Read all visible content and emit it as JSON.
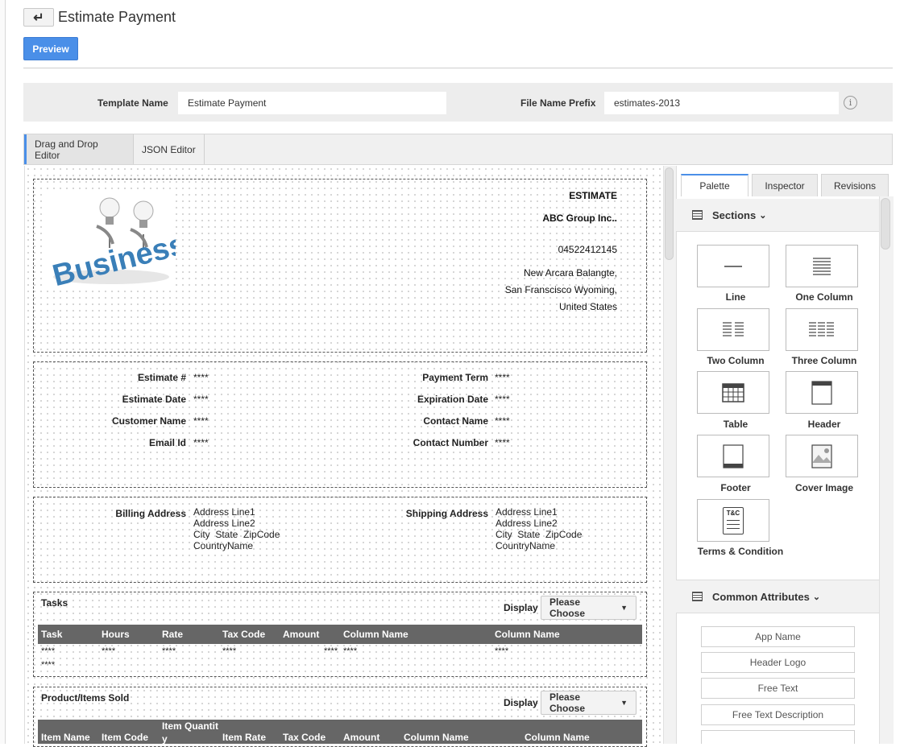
{
  "header": {
    "title": "Estimate Payment",
    "back_icon": "arrow-left-icon",
    "preview_label": "Preview"
  },
  "template": {
    "name_label": "Template Name",
    "name_value": "Estimate Payment",
    "prefix_label": "File Name Prefix",
    "prefix_value": "estimates-2013",
    "info_glyph": "i"
  },
  "editor_tabs": [
    {
      "label": "Drag and Drop Editor"
    },
    {
      "label": "JSON Editor"
    }
  ],
  "doc": {
    "heading": "ESTIMATE",
    "company": "ABC Group Inc..",
    "phone": "04522412145",
    "address": [
      "New Arcara Balangte,",
      "San Franscisco Wyoming,",
      "United States"
    ],
    "fields_left": [
      {
        "label": "Estimate #",
        "value": "****"
      },
      {
        "label": "Estimate Date",
        "value": "****"
      },
      {
        "label": "Customer Name",
        "value": "****"
      },
      {
        "label": "Email Id",
        "value": "****"
      }
    ],
    "fields_right": [
      {
        "label": "Payment Term",
        "value": "****"
      },
      {
        "label": "Expiration Date",
        "value": "****"
      },
      {
        "label": "Contact Name",
        "value": "****"
      },
      {
        "label": "Contact Number",
        "value": "****"
      }
    ],
    "billing": {
      "label": "Billing Address",
      "lines": [
        "Address Line1",
        "Address Line2",
        "City  State  ZipCode",
        "CountryName"
      ]
    },
    "shipping": {
      "label": "Shipping Address",
      "lines": [
        "Address Line1",
        "Address Line2",
        "City  State  ZipCode",
        "CountryName"
      ]
    },
    "tasks": {
      "title": "Tasks",
      "display_label": "Display",
      "choose_label": "Please Choose",
      "columns": [
        "Task",
        "Hours",
        "Rate",
        "Tax Code",
        "Amount",
        "Column Name",
        "Column Name"
      ],
      "cells": [
        "****",
        "****",
        "****",
        "****",
        "****",
        "****",
        "****"
      ],
      "extra": "****"
    },
    "products": {
      "title": "Product/Items Sold",
      "display_label": "Display",
      "choose_label": "Please Choose",
      "columns": [
        "Item Name",
        "Item Code",
        "Item Quantit y",
        "Item Rate",
        "Tax Code",
        "Amount",
        "Column Name",
        "Column Name"
      ]
    }
  },
  "panel": {
    "tabs": [
      {
        "label": "Palette"
      },
      {
        "label": "Inspector"
      },
      {
        "label": "Revisions"
      }
    ],
    "sections_title": "Sections",
    "tiles": [
      {
        "label": "Line",
        "icon": "line-icon"
      },
      {
        "label": "One Column",
        "icon": "one-column-icon"
      },
      {
        "label": "Two Column",
        "icon": "two-column-icon"
      },
      {
        "label": "Three Column",
        "icon": "three-column-icon"
      },
      {
        "label": "Table",
        "icon": "table-icon"
      },
      {
        "label": "Header",
        "icon": "header-icon"
      },
      {
        "label": "Footer",
        "icon": "footer-icon"
      },
      {
        "label": "Cover Image",
        "icon": "cover-image-icon"
      },
      {
        "label": "Terms & Condition",
        "icon": "terms-icon",
        "glyph": "T&C"
      }
    ],
    "common_title": "Common Attributes",
    "attributes": [
      "App Name",
      "Header Logo",
      "Free Text",
      "Free Text Description"
    ]
  }
}
